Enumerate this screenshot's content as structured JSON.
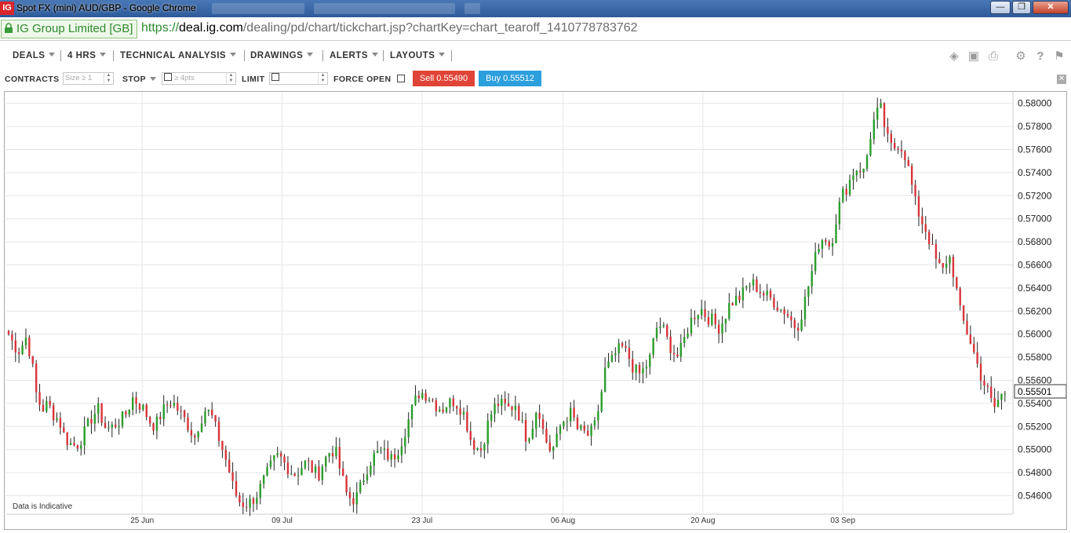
{
  "window": {
    "title": "Spot FX (mini) AUD/GBP - Google Chrome",
    "logo_text": "IG",
    "buttons": [
      "minimize",
      "maximize",
      "close"
    ]
  },
  "address_bar": {
    "security_label": "IG Group Limited [GB]",
    "url_protocol": "https://",
    "url_host": "deal.ig.com",
    "url_path": "/dealing/pd/chart/tickchart.jsp?chartKey=chart_tearoff_1410778783762"
  },
  "menu": {
    "items": [
      {
        "label": "DEALS"
      },
      {
        "label": "4 HRS"
      },
      {
        "label": "TECHNICAL ANALYSIS"
      },
      {
        "label": "DRAWINGS"
      },
      {
        "label": "ALERTS"
      },
      {
        "label": "LAYOUTS"
      }
    ],
    "tool_icons": [
      "layers-icon",
      "image-icon",
      "print-icon",
      "gear-icon",
      "help-icon",
      "comment-icon"
    ]
  },
  "deal_ticket": {
    "contracts_label": "CONTRACTS",
    "contracts_placeholder": "Size ≥ 1",
    "stop_label": "STOP",
    "stop_placeholder": "≥ 4pts",
    "limit_label": "LIMIT",
    "force_open_label": "FORCE OPEN",
    "sell_label": "Sell 0.55490",
    "buy_label": "Buy 0.55512",
    "colors": {
      "sell": "#e04438",
      "buy": "#2c9fdc"
    }
  },
  "chart_data": {
    "type": "candlestick",
    "instrument": "AUD/GBP",
    "interval": "4 HRS",
    "current_price_label": "0.55501",
    "current_price": 0.55501,
    "watermark": "Data is Indicative",
    "ylim": [
      0.5444,
      0.581
    ],
    "y_ticks": [
      0.546,
      0.548,
      0.55,
      0.552,
      0.554,
      0.556,
      0.558,
      0.56,
      0.562,
      0.564,
      0.566,
      0.568,
      0.57,
      0.572,
      0.574,
      0.576,
      0.578,
      0.58
    ],
    "y_tick_labels": [
      "0.54600",
      "0.54800",
      "0.55000",
      "0.55200",
      "0.55400",
      "0.55600",
      "0.55800",
      "0.56000",
      "0.56200",
      "0.56400",
      "0.56600",
      "0.56800",
      "0.57000",
      "0.57200",
      "0.57400",
      "0.57600",
      "0.57800",
      "0.58000"
    ],
    "x_labels": [
      "25 Jun",
      "09 Jul",
      "23 Jul",
      "06 Aug",
      "20 Aug",
      "03 Sep"
    ],
    "x_label_positions": [
      0.135,
      0.274,
      0.413,
      0.553,
      0.692,
      0.831
    ],
    "grid": true,
    "colors": {
      "up": "#2a9d2a",
      "down": "#d8343a",
      "wick": "#222222",
      "grid": "#e6e6e6"
    },
    "close_path": [
      0.56,
      0.559,
      0.5585,
      0.5598,
      0.558,
      0.5545,
      0.5535,
      0.554,
      0.553,
      0.5525,
      0.551,
      0.5505,
      0.5503,
      0.551,
      0.552,
      0.553,
      0.5535,
      0.552,
      0.5518,
      0.5522,
      0.5526,
      0.5532,
      0.5545,
      0.554,
      0.5535,
      0.5525,
      0.552,
      0.553,
      0.5538,
      0.5542,
      0.5535,
      0.5528,
      0.552,
      0.551,
      0.5525,
      0.5535,
      0.553,
      0.5515,
      0.55,
      0.5485,
      0.5465,
      0.5455,
      0.5452,
      0.5455,
      0.546,
      0.547,
      0.548,
      0.549,
      0.5495,
      0.5488,
      0.5482,
      0.5478,
      0.5485,
      0.549,
      0.5482,
      0.5478,
      0.549,
      0.5498,
      0.55,
      0.548,
      0.5462,
      0.5456,
      0.546,
      0.5475,
      0.5488,
      0.5495,
      0.5498,
      0.5496,
      0.5492,
      0.5498,
      0.551,
      0.5525,
      0.554,
      0.555,
      0.5548,
      0.5545,
      0.5538,
      0.5535,
      0.554,
      0.5542,
      0.5538,
      0.553,
      0.551,
      0.5502,
      0.55,
      0.552,
      0.5535,
      0.554,
      0.5538,
      0.5535,
      0.554,
      0.5525,
      0.551,
      0.552,
      0.554,
      0.5515,
      0.55,
      0.5502,
      0.552,
      0.5528,
      0.5532,
      0.5518,
      0.5515,
      0.5512,
      0.5518,
      0.554,
      0.557,
      0.5575,
      0.5585,
      0.5588,
      0.5582,
      0.557,
      0.5565,
      0.557,
      0.558,
      0.5605,
      0.5608,
      0.5595,
      0.5585,
      0.558,
      0.5595,
      0.561,
      0.5618,
      0.5622,
      0.5615,
      0.5612,
      0.5605,
      0.5612,
      0.5625,
      0.563,
      0.5632,
      0.564,
      0.5645,
      0.564,
      0.5635,
      0.5632,
      0.5628,
      0.5622,
      0.562,
      0.5612,
      0.5605,
      0.562,
      0.564,
      0.566,
      0.568,
      0.5685,
      0.5675,
      0.57,
      0.572,
      0.5728,
      0.574,
      0.5745,
      0.574,
      0.577,
      0.579,
      0.5795,
      0.577,
      0.576,
      0.5765,
      0.576,
      0.574,
      0.5715,
      0.57,
      0.569,
      0.5675,
      0.566,
      0.5655,
      0.567,
      0.565,
      0.562,
      0.5605,
      0.5592,
      0.5575,
      0.556,
      0.555,
      0.5535,
      0.5545,
      0.555
    ]
  }
}
